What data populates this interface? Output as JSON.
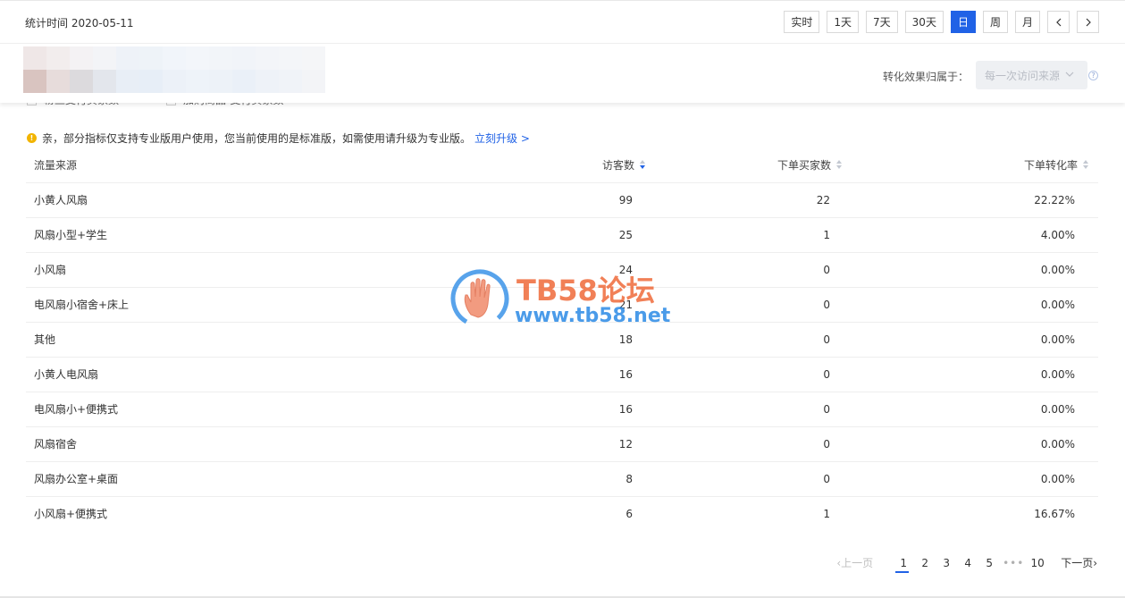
{
  "header": {
    "stat_time": "统计时间 2020-05-11",
    "periods": [
      "实时",
      "1天",
      "7天",
      "30天",
      "日",
      "周",
      "月"
    ],
    "active_period": "日",
    "prev_label": "‹",
    "next_label": "›"
  },
  "attribution": {
    "label": "转化效果归属于：",
    "select_value": "每一次访问来源",
    "help": "?"
  },
  "checkboxes": [
    {
      "label": "粉丝支付买家数",
      "checked": false
    },
    {
      "label": "加购商品-支付买家数",
      "checked": false
    }
  ],
  "notice": {
    "icon": "!",
    "text": "亲，部分指标仅支持专业版用户使用，您当前使用的是标准版，如需使用请升级为专业版。",
    "link": "立刻升级 >"
  },
  "table": {
    "columns": [
      "流量来源",
      "访客数",
      "下单买家数",
      "下单转化率"
    ],
    "sorted_column": "访客数",
    "rows": [
      {
        "source": "小黄人风扇",
        "visitors": "99",
        "buyers": "22",
        "rate": "22.22%"
      },
      {
        "source": "风扇小型+学生",
        "visitors": "25",
        "buyers": "1",
        "rate": "4.00%"
      },
      {
        "source": "小风扇",
        "visitors": "24",
        "buyers": "0",
        "rate": "0.00%"
      },
      {
        "source": "电风扇小宿舍+床上",
        "visitors": "21",
        "buyers": "0",
        "rate": "0.00%"
      },
      {
        "source": "其他",
        "visitors": "18",
        "buyers": "0",
        "rate": "0.00%"
      },
      {
        "source": "小黄人电风扇",
        "visitors": "16",
        "buyers": "0",
        "rate": "0.00%"
      },
      {
        "source": "电风扇小+便携式",
        "visitors": "16",
        "buyers": "0",
        "rate": "0.00%"
      },
      {
        "source": "风扇宿舍",
        "visitors": "12",
        "buyers": "0",
        "rate": "0.00%"
      },
      {
        "source": "风扇办公室+桌面",
        "visitors": "8",
        "buyers": "0",
        "rate": "0.00%"
      },
      {
        "source": "小风扇+便携式",
        "visitors": "6",
        "buyers": "1",
        "rate": "16.67%"
      }
    ]
  },
  "pagination": {
    "prev": "‹上一页",
    "pages": [
      "1",
      "2",
      "3",
      "4",
      "5"
    ],
    "ellipsis": "•••",
    "last": "10",
    "next": "下一页›",
    "current": "1"
  },
  "watermark": {
    "title": "TB58论坛",
    "url": "www.tb58.net"
  },
  "colors": {
    "accent": "#2062e6",
    "warning": "#f2b400",
    "watermark_orange": "#ef6a3a",
    "watermark_blue": "#2b8ae6"
  }
}
